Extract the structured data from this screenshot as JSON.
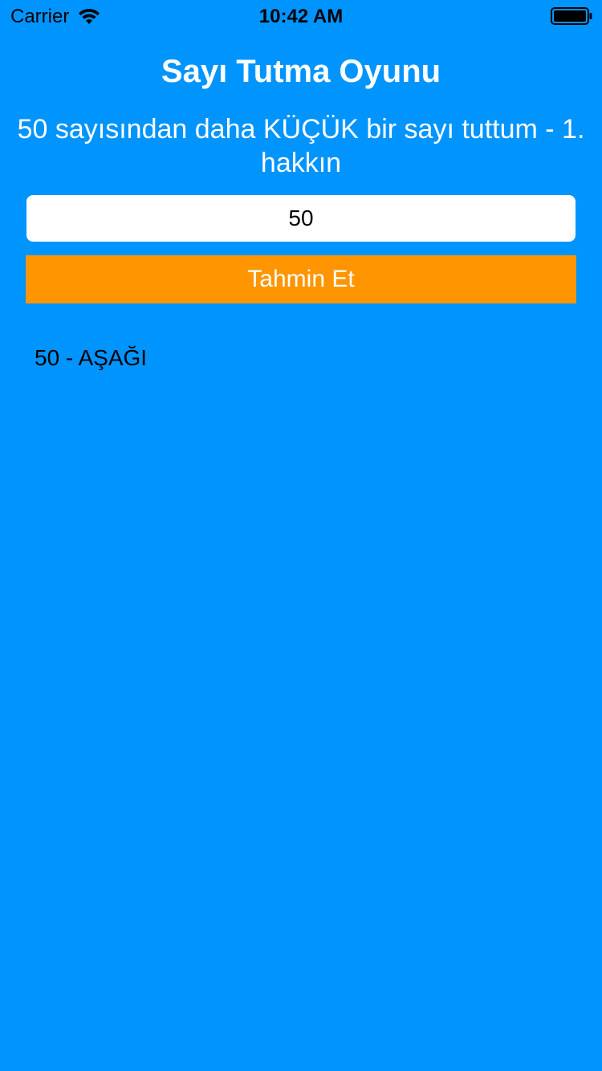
{
  "status_bar": {
    "carrier": "Carrier",
    "time": "10:42 AM",
    "wifi_icon": "wifi-icon",
    "battery_icon": "battery-icon"
  },
  "app": {
    "title": "Sayı Tutma Oyunu",
    "message": "50 sayısından daha KÜÇÜK bir sayı tuttum - 1. hakkın",
    "guess_input": {
      "value": "50",
      "placeholder": ""
    },
    "guess_button_label": "Tahmin Et",
    "history": [
      "50 - AŞAĞI"
    ]
  },
  "colors": {
    "background": "#0094FF",
    "button": "#FF9500",
    "input_background": "#FFFFFF",
    "title_text": "#FFFFFF",
    "history_text": "#000000"
  }
}
